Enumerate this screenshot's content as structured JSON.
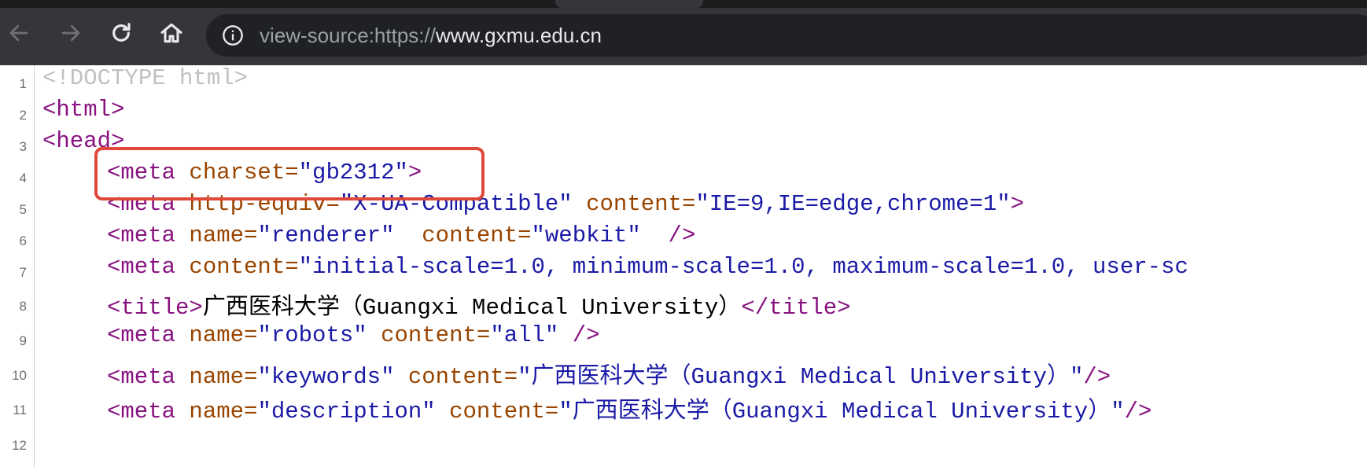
{
  "toolbar": {
    "back_icon": "arrow-left-icon",
    "forward_icon": "arrow-right-icon",
    "reload_icon": "reload-icon",
    "home_icon": "home-icon",
    "info_icon": "info-circle-icon",
    "url_prefix": "view-source:https://",
    "url_host": "www.gxmu.edu.cn"
  },
  "colors": {
    "toolbar_bg": "#35363a",
    "omnibox_bg": "#202124",
    "tag": "#881280",
    "attr_name": "#994500",
    "attr_value": "#1a1aa6",
    "doctype": "#c0c0c0",
    "highlight": "#e0493a"
  },
  "source": {
    "line_numbers": [
      "1",
      "2",
      "3",
      "4",
      "5",
      "6",
      "7",
      "8",
      "9",
      "10",
      "11",
      "12"
    ],
    "l1": {
      "doctype": "<!DOCTYPE html>"
    },
    "l2": {
      "tag": "<html>"
    },
    "l3": {
      "tag": "<head>"
    },
    "l4": {
      "open": "<meta ",
      "a1": "charset=",
      "v1": "\"gb2312\"",
      "close": ">"
    },
    "l5": {
      "open": "<meta ",
      "a1": "http-equiv=",
      "v1": "\"X-UA-Compatible\"",
      "a2": " content=",
      "v2": "\"IE=9,IE=edge,chrome=1\"",
      "close": ">"
    },
    "l6": {
      "open": "<meta ",
      "a1": "name=",
      "v1": "\"renderer\"",
      "a2": "  content=",
      "v2": "\"webkit\"",
      "close": "  />"
    },
    "l7": {
      "open": "<meta ",
      "a1": "content=",
      "v1": "\"initial-scale=1.0, minimum-scale=1.0, maximum-scale=1.0, user-sc"
    },
    "l8": {
      "open": "<title>",
      "text": "广西医科大学（Guangxi Medical University）",
      "close": "</title>"
    },
    "l9": {
      "open": "<meta ",
      "a1": "name=",
      "v1": "\"robots\"",
      "a2": " content=",
      "v2": "\"all\"",
      "close": " />"
    },
    "l10": {
      "open": "<meta ",
      "a1": "name=",
      "v1": "\"keywords\"",
      "a2": " content=",
      "v2": "\"广西医科大学（Guangxi Medical University）\"",
      "close": "/>"
    },
    "l11": {
      "open": "<meta ",
      "a1": "name=",
      "v1": "\"description\"",
      "a2": " content=",
      "v2": "\"广西医科大学（Guangxi Medical University）\"",
      "close": "/>"
    }
  }
}
